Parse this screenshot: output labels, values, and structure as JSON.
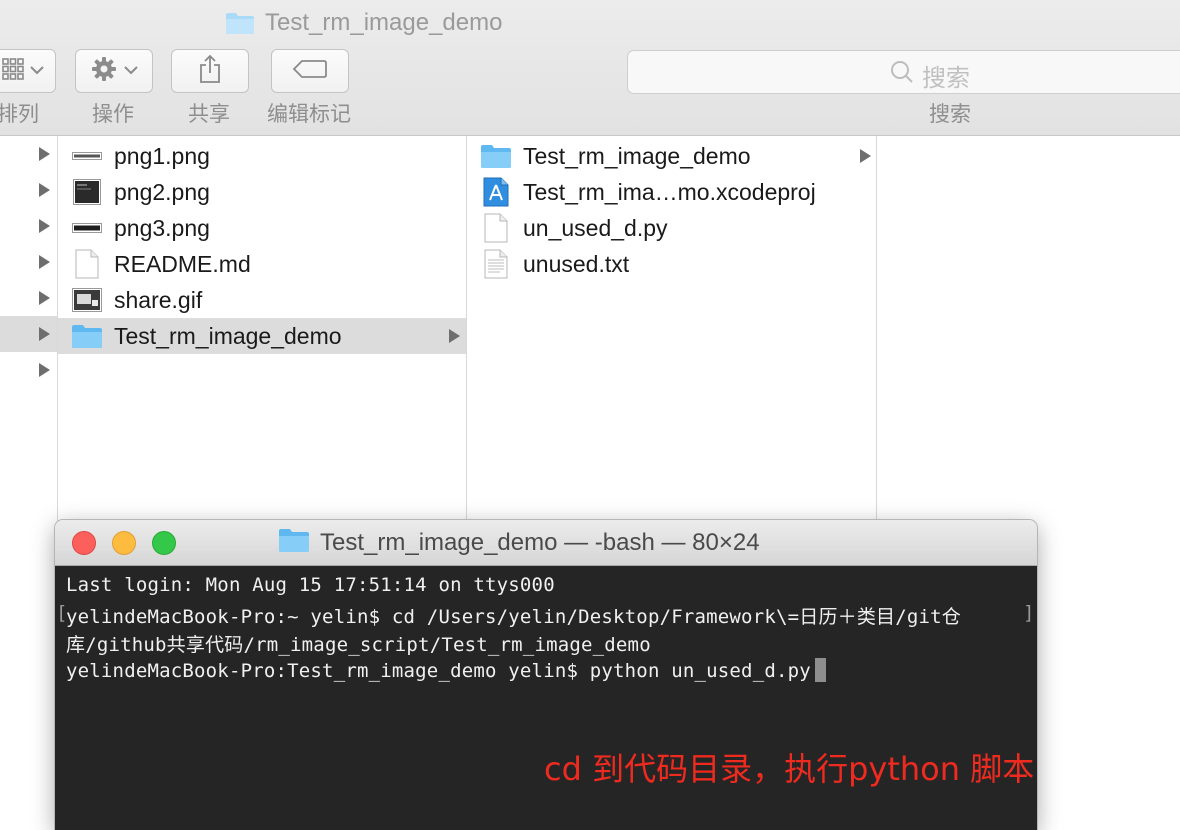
{
  "finder": {
    "title": "Test_rm_image_demo",
    "toolbar": {
      "arrange_label": "排列",
      "action_label": "操作",
      "share_label": "共享",
      "tags_label": "编辑标记",
      "search_placeholder": "搜索",
      "search_label": "搜索"
    },
    "column1": [
      {
        "name": "png1.png",
        "icon": "image-thumb-icon"
      },
      {
        "name": "png2.png",
        "icon": "image-thumb-icon"
      },
      {
        "name": "png3.png",
        "icon": "image-thumb-icon"
      },
      {
        "name": "README.md",
        "icon": "document-icon"
      },
      {
        "name": "share.gif",
        "icon": "image-thumb-icon"
      },
      {
        "name": "Test_rm_image_demo",
        "icon": "folder-icon",
        "selected": true
      }
    ],
    "column2": [
      {
        "name": "Test_rm_image_demo",
        "icon": "folder-icon"
      },
      {
        "name": "Test_rm_ima…mo.xcodeproj",
        "icon": "xcodeproj-icon"
      },
      {
        "name": "un_used_d.py",
        "icon": "document-icon"
      },
      {
        "name": "unused.txt",
        "icon": "text-document-icon"
      }
    ]
  },
  "terminal": {
    "title": "Test_rm_image_demo — -bash — 80×24",
    "lines": {
      "line1": "Last login: Mon Aug 15 17:51:14 on ttys000",
      "line2": "yelindeMacBook-Pro:~ yelin$ cd /Users/yelin/Desktop/Framework\\=日历＋类目/git仓",
      "line3": "库/github共享代码/rm_image_script/Test_rm_image_demo",
      "line4": "yelindeMacBook-Pro:Test_rm_image_demo yelin$ python un_used_d.py"
    },
    "annotation": "cd 到代码目录，执行python 脚本"
  },
  "colors": {
    "annotation": "#ef2a1f",
    "terminal_bg": "#252525",
    "folder": "#6ec3f4",
    "selection": "#dcdcdc"
  }
}
